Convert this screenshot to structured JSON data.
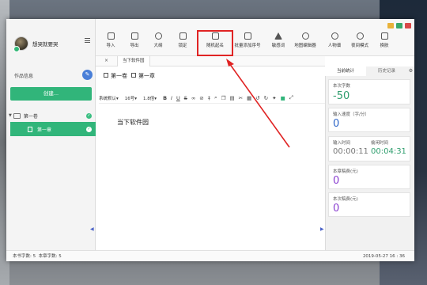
{
  "app": {
    "username": "想哭就要哭",
    "work_info_label": "作品信息",
    "create_button": "创建...",
    "volume": "第一卷",
    "chapter": "第一章"
  },
  "toolbar": {
    "items": [
      {
        "label": "导入",
        "icon": "import-icon"
      },
      {
        "label": "导出",
        "icon": "export-icon"
      },
      {
        "label": "大纲",
        "icon": "outline-icon"
      },
      {
        "label": "锁定",
        "icon": "lock-icon"
      },
      {
        "label": "随机起名",
        "icon": "random-name-icon"
      },
      {
        "label": "批量添加序号",
        "icon": "batch-number-icon"
      },
      {
        "label": "敏感词",
        "icon": "sensitive-word-icon"
      },
      {
        "label": "地图编辑器",
        "icon": "map-editor-icon"
      },
      {
        "label": "人物谱",
        "icon": "character-icon"
      },
      {
        "label": "夜间模式",
        "icon": "night-mode-icon"
      },
      {
        "label": "换肤",
        "icon": "skin-icon"
      }
    ],
    "highlighted": "随机起名"
  },
  "tabs": [
    {
      "label": "当下软件园",
      "close": "×"
    }
  ],
  "breadcrumb": {
    "volume": "第一卷",
    "chapter": "第一章"
  },
  "format_bar": {
    "font": "系统默认",
    "size": "16号",
    "line_height": "1.8倍",
    "bold": "B",
    "italic": "I",
    "underline": "U",
    "strike": "S"
  },
  "editor": {
    "content": "当下软件园"
  },
  "right_panel": {
    "tab_stats": "当前统计",
    "tab_history": "历史记录",
    "session_words_label": "本次字数",
    "session_words_value": "-50",
    "input_speed_label": "输入速度（字/分）",
    "input_speed_value": "0",
    "input_time_label": "输入时间",
    "input_time_value": "00:00:11",
    "idle_time_label": "偷闲时间",
    "idle_time_value": "00:04:31",
    "chapter_fee_label": "本章稿费(元)",
    "chapter_fee_value": "0",
    "session_fee_label": "本次稿费(元)",
    "session_fee_value": "0"
  },
  "status": {
    "book_words": "本书字数: 5",
    "chapter_words": "本章字数: 5",
    "datetime": "2019-05-27 16 : 36"
  },
  "colors": {
    "brand_green": "#31b57a",
    "accent_blue": "#4a62c8",
    "words_green": "#2f9e6e",
    "speed_blue": "#2f67c9",
    "fee_purple": "#8a3fd0",
    "highlight_red": "#e02424"
  }
}
